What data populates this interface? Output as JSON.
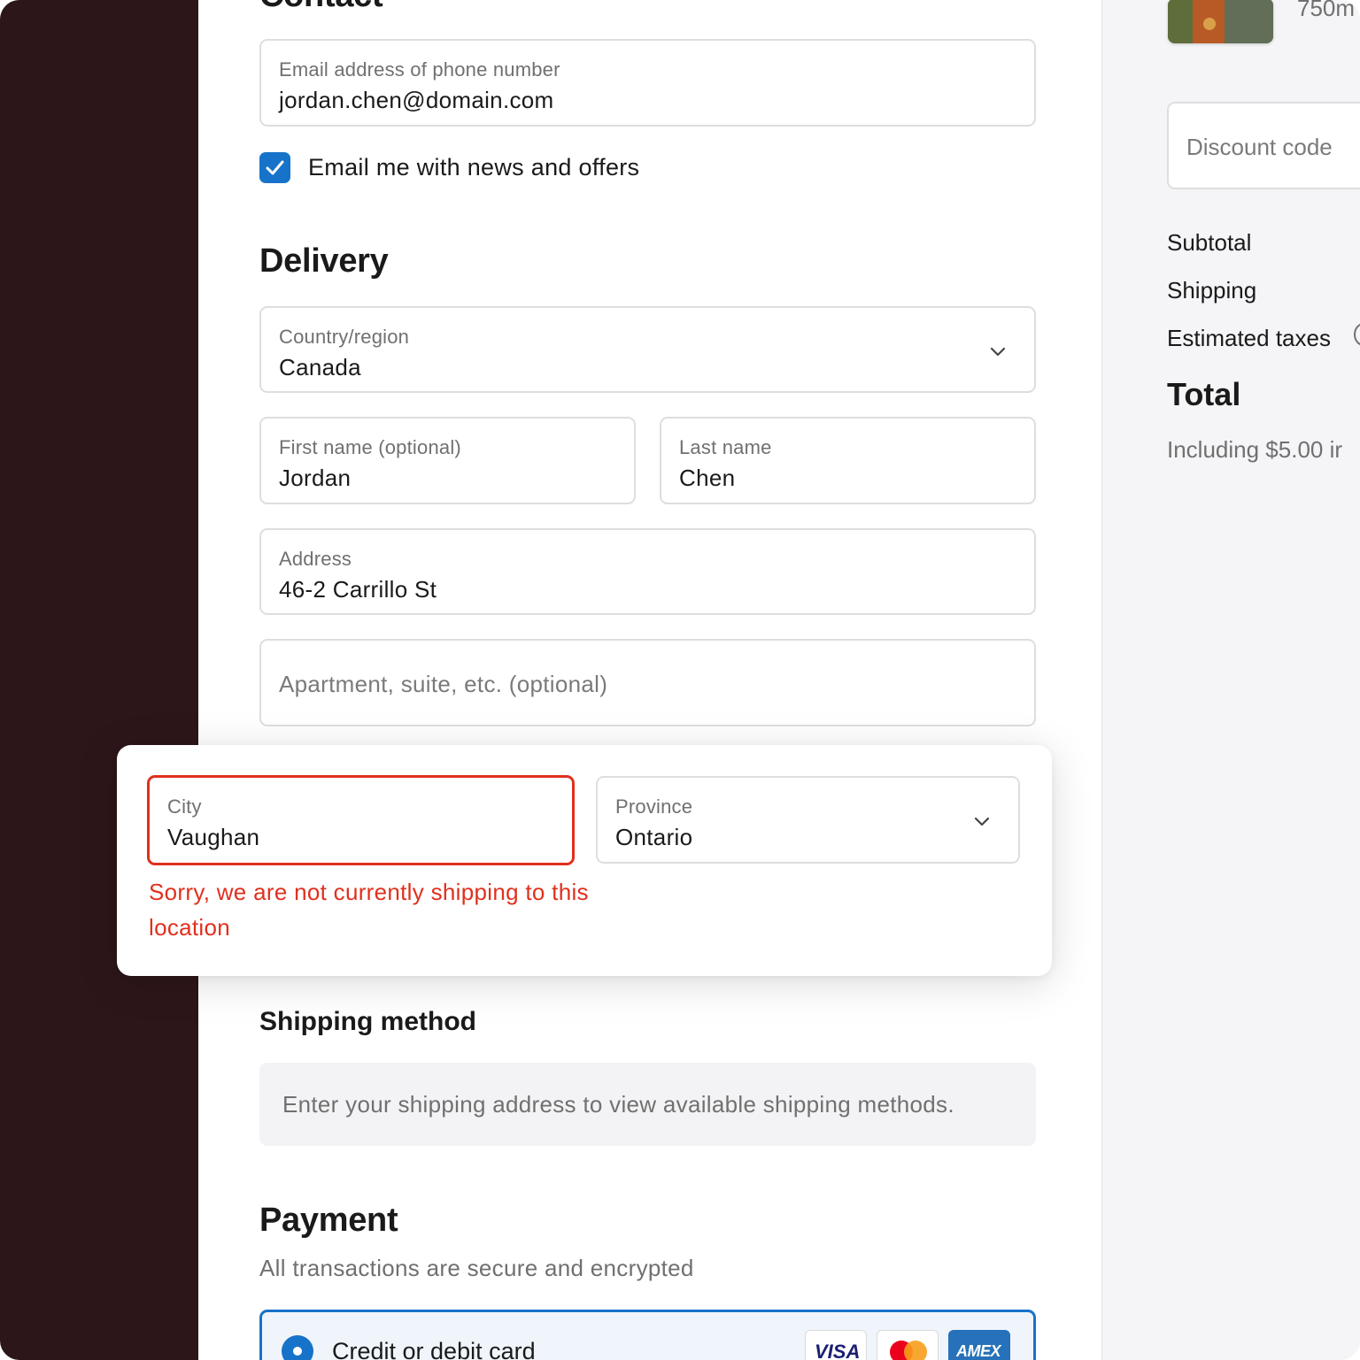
{
  "contact": {
    "heading": "Contact",
    "email_label": "Email address of phone number",
    "email_value": "jordan.chen@domain.com",
    "news_checkbox_label": "Email me with news and offers",
    "news_checked": true
  },
  "delivery": {
    "heading": "Delivery",
    "country_label": "Country/region",
    "country_value": "Canada",
    "first_name_label": "First name (optional)",
    "first_name_value": "Jordan",
    "last_name_label": "Last name",
    "last_name_value": "Chen",
    "address_label": "Address",
    "address_value": "46-2 Carrillo St",
    "apartment_placeholder": "Apartment, suite, etc. (optional)",
    "city_label": "City",
    "city_value": "Vaughan",
    "province_label": "Province",
    "province_value": "Ontario",
    "city_error": "Sorry, we are not currently shipping to this location"
  },
  "shipping_method": {
    "heading": "Shipping method",
    "notice": "Enter your shipping address to view available shipping methods."
  },
  "payment": {
    "heading": "Payment",
    "subtext": "All transactions are secure and encrypted",
    "option_label": "Credit or debit card",
    "cards": [
      "VISA",
      "Mastercard",
      "AMEX"
    ]
  },
  "summary": {
    "product_size": "750m",
    "discount_placeholder": "Discount code",
    "subtotal_label": "Subtotal",
    "shipping_label": "Shipping",
    "taxes_label": "Estimated taxes",
    "total_label": "Total",
    "including_text": "Including $5.00 ir"
  },
  "colors": {
    "accent": "#1773c9",
    "error": "#e0301e",
    "left_panel": "#2d1619",
    "sidebar_bg": "#f5f5f7"
  }
}
